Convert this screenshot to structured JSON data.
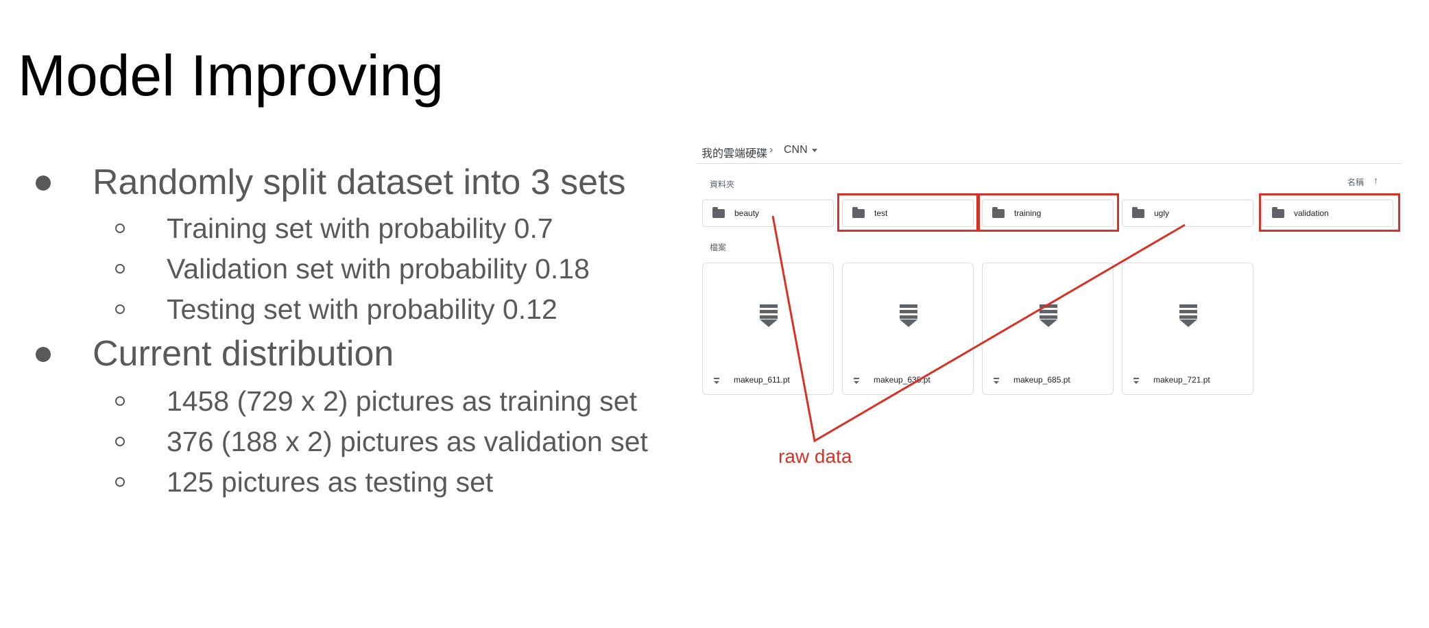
{
  "slide": {
    "title": "Model Improving",
    "bullets": [
      {
        "text": "Randomly split dataset into 3 sets",
        "sub": [
          "Training set with probability 0.7",
          "Validation set with probability 0.18",
          "Testing set with probability 0.12"
        ]
      },
      {
        "text": "Current distribution",
        "sub": [
          "1458 (729 x 2) pictures as training set",
          "376 (188 x 2) pictures as validation set",
          "125 pictures as testing set"
        ]
      }
    ]
  },
  "drive": {
    "breadcrumb": {
      "root": "我的雲端硬碟",
      "separator": "›",
      "current": "CNN",
      "dropdown_icon": "caret-down-icon"
    },
    "folders_label": "資料夾",
    "sort_label": "名稱",
    "sort_icon": "arrow-up-icon",
    "folders": [
      "beauty",
      "test",
      "training",
      "ugly",
      "validation"
    ],
    "files_label": "檔案",
    "files": [
      "makeup_611.pt",
      "makeup_635.pt",
      "makeup_685.pt",
      "makeup_721.pt"
    ]
  },
  "annotation": {
    "label": "raw data",
    "color": "#d93025",
    "highlighted_folders": [
      "test",
      "training",
      "validation"
    ]
  }
}
